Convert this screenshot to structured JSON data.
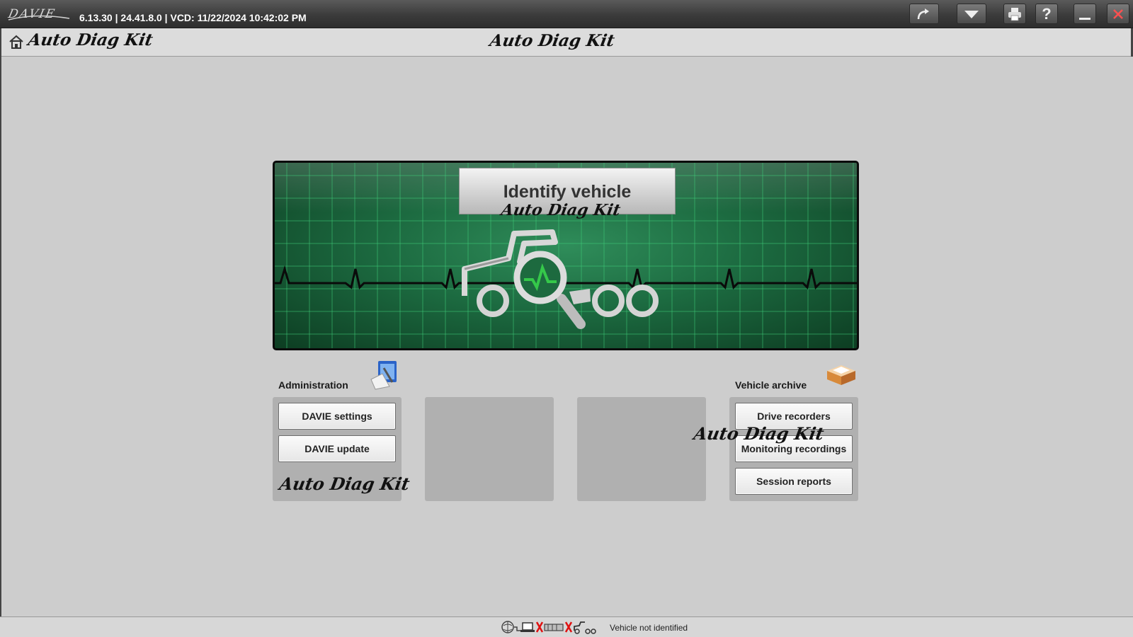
{
  "app": {
    "logo_text": "DAVIE",
    "version_line": "6.13.30 | 24.41.8.0 | VCD: 11/22/2024 10:42:02 PM"
  },
  "toolbar": {
    "icons": [
      "redo-arrow-icon",
      "dropdown-triangle-icon",
      "printer-icon",
      "help-icon",
      "minimize-icon",
      "close-icon"
    ],
    "help_label": "?"
  },
  "breadcrumb": {
    "title": "Auto Diag Kit"
  },
  "page": {
    "title": "Auto Diag Kit"
  },
  "hero": {
    "button_label": "Identify vehicle",
    "watermark": "Auto Diag Kit",
    "icon": "truck-magnifier-icon"
  },
  "administration": {
    "label": "Administration",
    "icon": "admin-tools-icon",
    "buttons": [
      "DAVIE settings",
      "DAVIE update"
    ],
    "watermark": "Auto Diag Kit"
  },
  "vehicle_archive": {
    "label": "Vehicle archive",
    "icon": "archive-box-icon",
    "buttons": [
      "Drive recorders",
      "Monitoring recordings",
      "Session reports"
    ],
    "watermark": "Auto Diag Kit"
  },
  "status": {
    "text": "Vehicle not identified",
    "icons": [
      "globe-icon",
      "laptop-icon",
      "disconnected-x-icon",
      "vci-icon",
      "disconnected-x-icon",
      "truck-small-icon"
    ]
  },
  "colors": {
    "hero_green": "#1c6a40",
    "grid_line": "#3fd07a",
    "error_red": "#e01010",
    "titlebar": "#3b3b3b"
  }
}
